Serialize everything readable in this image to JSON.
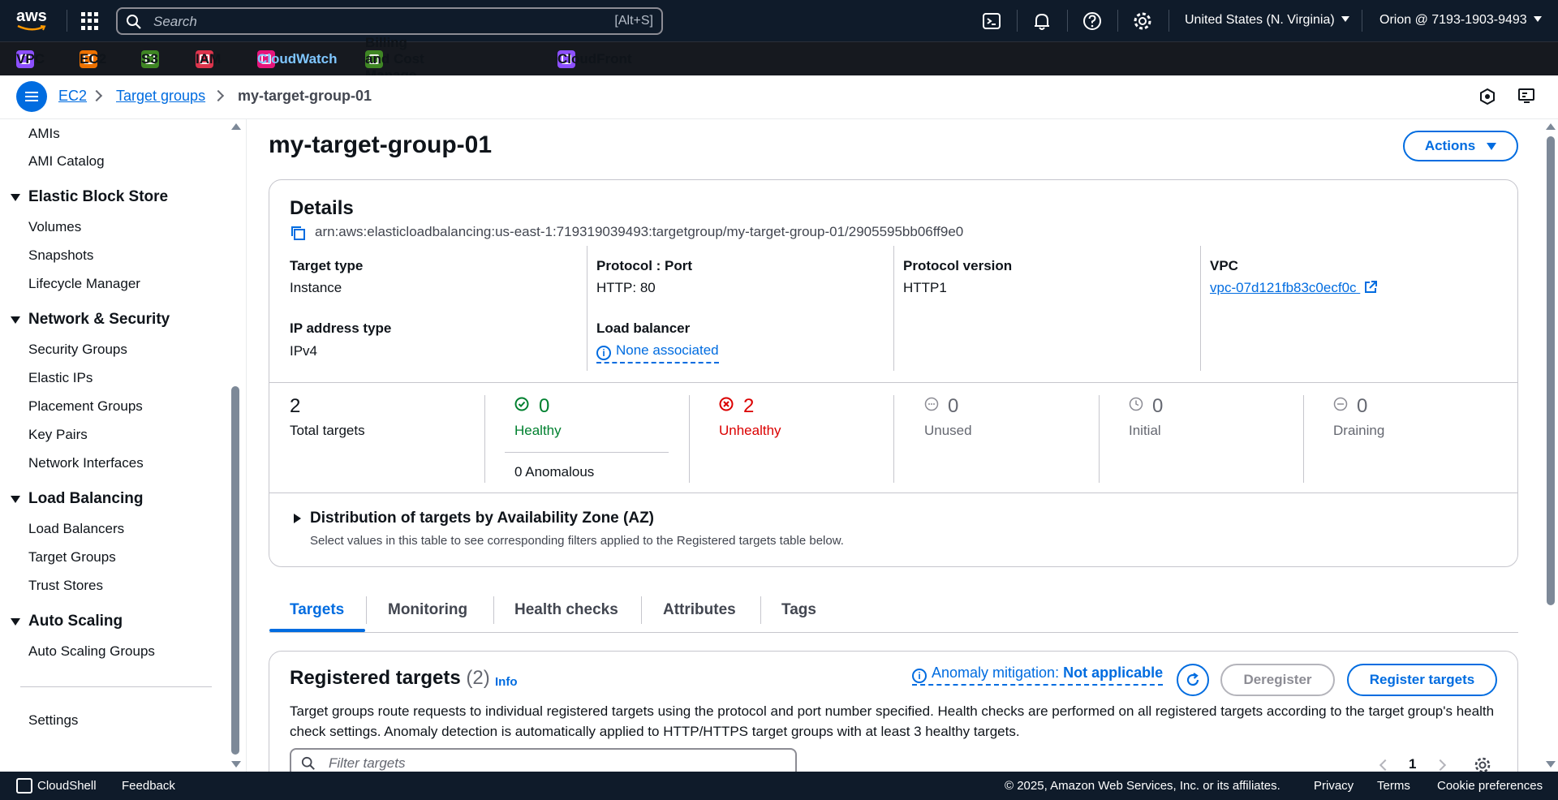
{
  "topnav": {
    "logo_text": "aws",
    "search_placeholder": "Search",
    "search_shortcut": "[Alt+S]",
    "region": "United States (N. Virginia)",
    "account": "Orion @ 7193-1903-9493"
  },
  "favorites": [
    {
      "label": "VPC",
      "color": "#8c4fff"
    },
    {
      "label": "EC2",
      "color": "#ed7100"
    },
    {
      "label": "S3",
      "color": "#3f8624"
    },
    {
      "label": "IAM",
      "color": "#dd344c"
    },
    {
      "label": "CloudWatch",
      "color": "#e7157b"
    },
    {
      "label": "Billing and Cost Manage...",
      "color": "#3f8624"
    },
    {
      "label": "CloudFront",
      "color": "#8c4fff"
    }
  ],
  "breadcrumb": {
    "items": [
      "EC2",
      "Target groups"
    ],
    "current": "my-target-group-01"
  },
  "sidebar": {
    "top_items": [
      "AMIs",
      "AMI Catalog"
    ],
    "ebs": {
      "title": "Elastic Block Store",
      "items": [
        "Volumes",
        "Snapshots",
        "Lifecycle Manager"
      ]
    },
    "netsec": {
      "title": "Network & Security",
      "items": [
        "Security Groups",
        "Elastic IPs",
        "Placement Groups",
        "Key Pairs",
        "Network Interfaces"
      ]
    },
    "lb": {
      "title": "Load Balancing",
      "items": [
        "Load Balancers",
        "Target Groups",
        "Trust Stores"
      ]
    },
    "as": {
      "title": "Auto Scaling",
      "items": [
        "Auto Scaling Groups"
      ]
    },
    "settings": "Settings"
  },
  "page": {
    "title": "my-target-group-01",
    "actions_label": "Actions"
  },
  "details": {
    "title": "Details",
    "arn": "arn:aws:elasticloadbalancing:us-east-1:719319039493:targetgroup/my-target-group-01/2905595bb06ff9e0",
    "target_type_label": "Target type",
    "target_type": "Instance",
    "protocol_port_label": "Protocol : Port",
    "protocol_port": "HTTP: 80",
    "protocol_version_label": "Protocol version",
    "protocol_version": "HTTP1",
    "vpc_label": "VPC",
    "vpc": "vpc-07d121fb83c0ecf0c",
    "ip_type_label": "IP address type",
    "ip_type": "IPv4",
    "lb_label": "Load balancer",
    "lb": "None associated"
  },
  "stats": {
    "total": {
      "value": "2",
      "label": "Total targets"
    },
    "healthy": {
      "value": "0",
      "label": "Healthy"
    },
    "anomalous": "0 Anomalous",
    "unhealthy": {
      "value": "2",
      "label": "Unhealthy"
    },
    "unused": {
      "value": "0",
      "label": "Unused"
    },
    "initial": {
      "value": "0",
      "label": "Initial"
    },
    "draining": {
      "value": "0",
      "label": "Draining"
    }
  },
  "az": {
    "title": "Distribution of targets by Availability Zone (AZ)",
    "desc": "Select values in this table to see corresponding filters applied to the Registered targets table below."
  },
  "tabs": [
    "Targets",
    "Monitoring",
    "Health checks",
    "Attributes",
    "Tags"
  ],
  "registered": {
    "title": "Registered targets",
    "count": "(2)",
    "info": "Info",
    "anomaly_label": "Anomaly mitigation:",
    "anomaly_value": "Not applicable",
    "deregister": "Deregister",
    "register": "Register targets",
    "desc": "Target groups route requests to individual registered targets using the protocol and port number specified. Health checks are performed on all registered targets according to the target group's health check settings. Anomaly detection is automatically applied to HTTP/HTTPS target groups with at least 3 healthy targets.",
    "filter_placeholder": "Filter targets",
    "page": "1"
  },
  "footer": {
    "cloudshell": "CloudShell",
    "feedback": "Feedback",
    "copyright": "© 2025, Amazon Web Services, Inc. or its affiliates.",
    "privacy": "Privacy",
    "terms": "Terms",
    "cookies": "Cookie preferences"
  }
}
